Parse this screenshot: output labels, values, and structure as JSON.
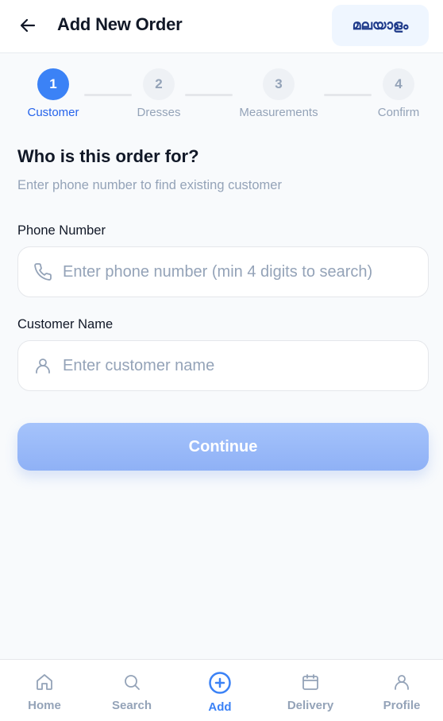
{
  "header": {
    "title": "Add New Order",
    "language_label": "മലയാളം",
    "back_icon": "arrow-left-icon"
  },
  "stepper": {
    "current_step": 1,
    "steps": [
      {
        "number": "1",
        "label": "Customer",
        "active": true
      },
      {
        "number": "2",
        "label": "Dresses",
        "active": false
      },
      {
        "number": "3",
        "label": "Measurements",
        "active": false
      },
      {
        "number": "4",
        "label": "Confirm",
        "active": false
      }
    ]
  },
  "form": {
    "title": "Who is this order for?",
    "subtitle": "Enter phone number to find existing customer",
    "phone": {
      "label": "Phone Number",
      "placeholder": "Enter phone number (min 4 digits to search)",
      "value": "",
      "icon": "phone-icon"
    },
    "name": {
      "label": "Customer Name",
      "placeholder": "Enter customer name",
      "value": "",
      "icon": "user-icon"
    },
    "continue_label": "Continue"
  },
  "bottom_nav": {
    "items": [
      {
        "label": "Home",
        "icon": "home-icon",
        "active": false
      },
      {
        "label": "Search",
        "icon": "search-icon",
        "active": false
      },
      {
        "label": "Add",
        "icon": "plus-circle-icon",
        "active": true
      },
      {
        "label": "Delivery",
        "icon": "calendar-icon",
        "active": false
      },
      {
        "label": "Profile",
        "icon": "user-icon",
        "active": false
      }
    ]
  },
  "colors": {
    "accent": "#3b82f6",
    "button_disabled": "#93b4f8",
    "muted_text": "#94a3b8",
    "background": "#f8fafc"
  }
}
